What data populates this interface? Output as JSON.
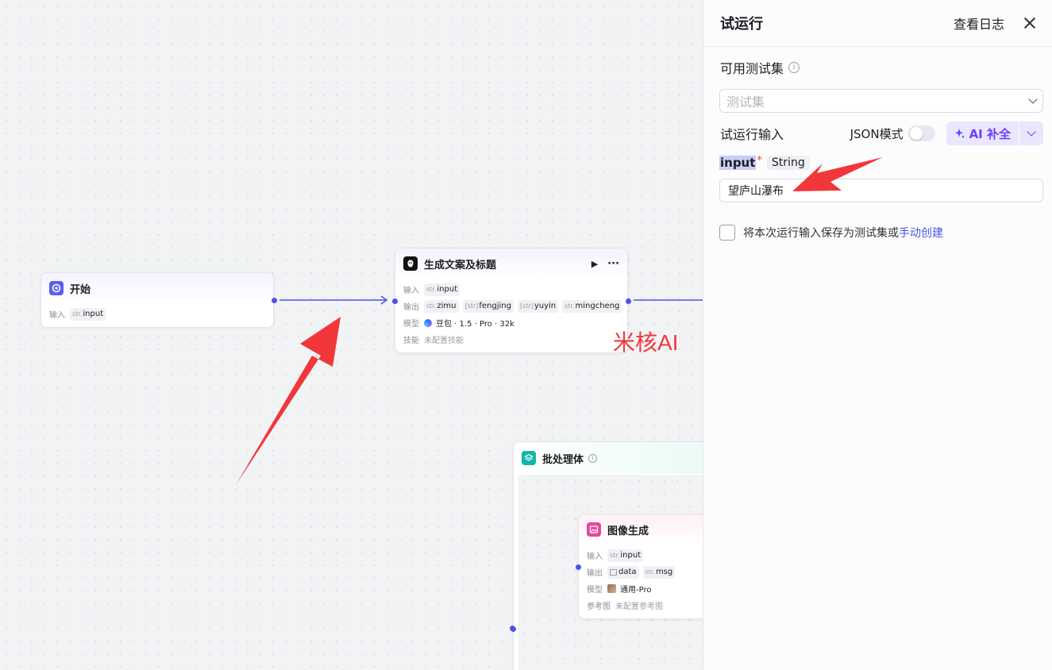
{
  "canvas": {
    "start_node": {
      "title": "开始",
      "input_label": "输入",
      "input_var": {
        "type": "str.",
        "name": "input"
      }
    },
    "llm_node": {
      "title": "生成文案及标题",
      "run_symbol": "▶",
      "more_symbol": "···",
      "input_label": "输入",
      "input_var": {
        "type": "str.",
        "name": "input"
      },
      "output_label": "输出",
      "outputs": [
        {
          "type": "str.",
          "name": "zimu"
        },
        {
          "type": "[str]",
          "name": "fengjing"
        },
        {
          "type": "[str]",
          "name": "yuyin"
        },
        {
          "type": "str.",
          "name": "mingcheng"
        }
      ],
      "model_label": "模型",
      "model_value": "豆包 · 1.5 · Pro · 32k",
      "skill_label": "技能",
      "skill_value": "未配置技能"
    },
    "batch_node": {
      "title": "批处理体"
    },
    "image_node": {
      "title": "图像生成",
      "input_label": "输入",
      "input_var": {
        "type": "str.",
        "name": "input"
      },
      "output_label": "输出",
      "outputs": [
        {
          "type": "img",
          "name": "data"
        },
        {
          "type": "str.",
          "name": "msg"
        }
      ],
      "model_label": "模型",
      "model_value": "通用-Pro",
      "ref_label": "参考图",
      "ref_value": "未配置参考图"
    },
    "watermark": "米核AI",
    "edge_color": "#4d53e8",
    "annotation_arrow_color": "#f2373b"
  },
  "panel": {
    "title": "试运行",
    "view_log": "查看日志",
    "testset_label": "可用测试集",
    "testset_placeholder": "测试集",
    "run_input_label": "试运行输入",
    "json_mode_label": "JSON模式",
    "json_mode_on": false,
    "ai_button_label": "AI 补全",
    "field": {
      "name": "input",
      "required_mark": "*",
      "type": "String",
      "value": "望庐山瀑布"
    },
    "save_text": "将本次运行输入保存为测试集或",
    "save_link": "手动创建",
    "accent_color": "#4d53e8"
  }
}
